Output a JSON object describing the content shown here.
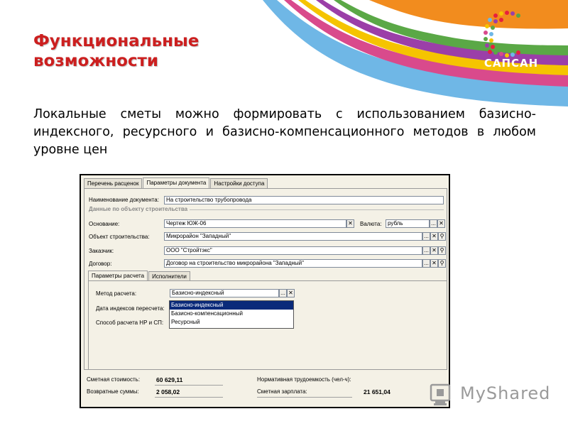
{
  "slide": {
    "title_line1": "Функциональные",
    "title_line2": "возможности",
    "description": "Локальные сметы можно формировать с использованием базисно-индексного, ресурсного и базисно-компенсационного методов в любом уровне цен",
    "logo_text": "САПСАН",
    "watermark": {
      "text_my": "My",
      "text_rest": "Shared"
    },
    "colors": {
      "title": "#cc1f1f",
      "logo_bg": "#f28c1e",
      "selection": "#0a2a7a"
    }
  },
  "app": {
    "tabs": [
      "Перечень расценок",
      "Параметры документа",
      "Настройки доступа"
    ],
    "document_name_label": "Наименование документа:",
    "document_name_value": "На строительство трубопровода",
    "section_label": "Данные по объекту строительства",
    "basis_label": "Основание:",
    "basis_value": "Чертеж ЮЖ-06",
    "currency_label": "Валюта:",
    "currency_value": "рубль",
    "object_label": "Объект строительства:",
    "object_value": "Микрорайон \"Западный\"",
    "customer_label": "Заказчик:",
    "customer_value": "ООО \"Стройтэкс\"",
    "contract_label": "Договор:",
    "contract_value": "Договор на строительство микрорайона \"Западный\"",
    "subtabs": [
      "Параметры расчета",
      "Исполнители"
    ],
    "method_label": "Метод расчета:",
    "method_value": "Базисно-индексный",
    "index_date_label": "Дата индексов пересчета:",
    "np_sp_label": "Способ расчета НР и СП:",
    "method_options": [
      "Базисно-индексный",
      "Базисно-компенсационный",
      "Ресурсный"
    ],
    "buttons": {
      "select": "...",
      "clear": "✕",
      "open": "🔍"
    },
    "totals": {
      "estimate_cost_label": "Сметная стоимость:",
      "estimate_cost_value": "60 629,11",
      "returnable_label": "Возвратные суммы:",
      "returnable_value": "2 058,02",
      "labor_label": "Нормативная трудоемкость (чел-ч):",
      "labor_value": "",
      "salary_label": "Сметная зарплата:",
      "salary_value": "21 651,04"
    }
  }
}
